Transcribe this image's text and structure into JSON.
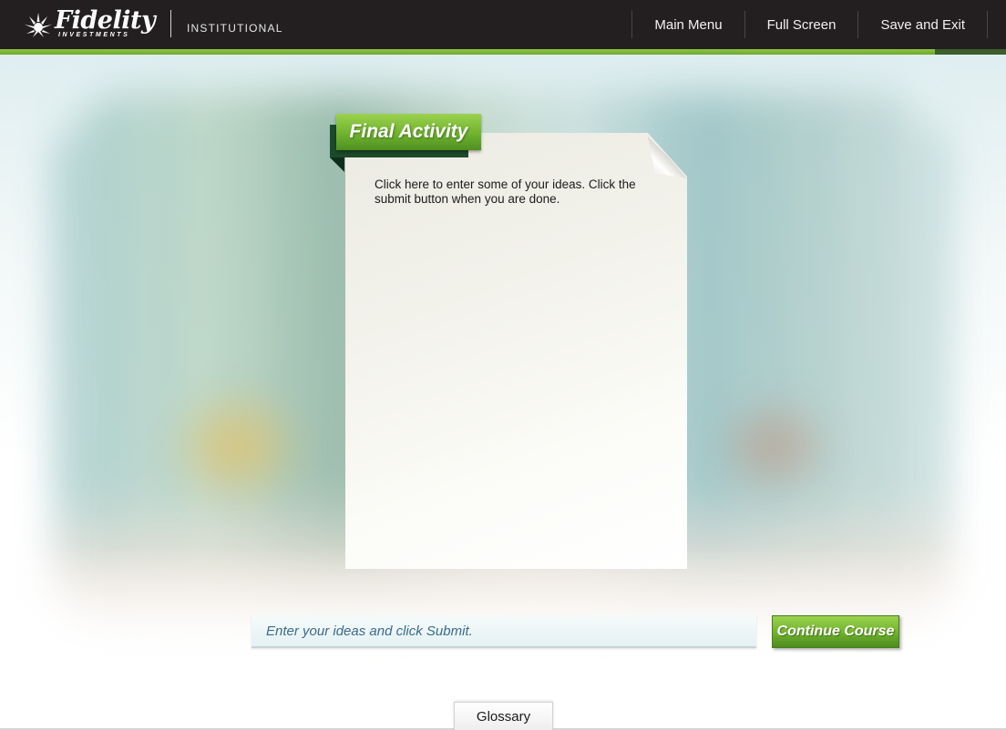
{
  "header": {
    "logo_word": "Fidelity",
    "logo_sub": "INVESTMENTS",
    "institutional": "INSTITUTIONAL",
    "nav": [
      {
        "label": "Main Menu"
      },
      {
        "label": "Full Screen"
      },
      {
        "label": "Save and Exit"
      }
    ]
  },
  "activity": {
    "tab_label": "Final Activity",
    "instructions": "Click here to enter some of your ideas. Click the submit button when you are done."
  },
  "input": {
    "placeholder": "Enter your ideas and click Submit.",
    "value": ""
  },
  "continue_label": "Continue Course",
  "glossary_label": "Glossary",
  "colors": {
    "header_bg": "#231f20",
    "accent_green": "#72b52f",
    "dark_green": "#1c4a2a"
  }
}
